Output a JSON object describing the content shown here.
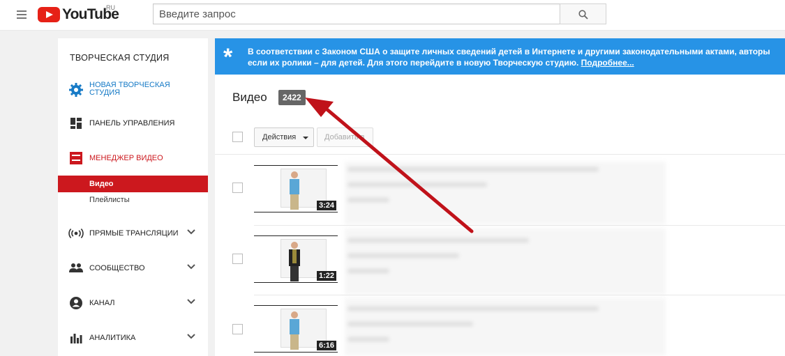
{
  "header": {
    "logo_text": "YouTube",
    "logo_region": "RU",
    "search_placeholder": "Введите запрос"
  },
  "sidebar": {
    "title": "ТВОРЧЕСКАЯ СТУДИЯ",
    "new_studio_line1": "НОВАЯ ТВОРЧЕСКАЯ",
    "new_studio_line2": "СТУДИЯ",
    "items": [
      {
        "label": "ПАНЕЛЬ УПРАВЛЕНИЯ",
        "icon": "dashboard-icon"
      },
      {
        "label": "МЕНЕДЖЕР ВИДЕО",
        "icon": "video-manager-icon"
      },
      {
        "label": "ПРЯМЫЕ ТРАНСЛЯЦИИ",
        "icon": "live-icon"
      },
      {
        "label": "СООБЩЕСТВО",
        "icon": "community-icon"
      },
      {
        "label": "КАНАЛ",
        "icon": "channel-icon"
      },
      {
        "label": "АНАЛИТИКА",
        "icon": "analytics-icon"
      }
    ],
    "sub_items": [
      {
        "label": "Видео",
        "active": true
      },
      {
        "label": "Плейлисты",
        "active": false
      }
    ]
  },
  "banner": {
    "line1": "В соответствии с Законом США о защите личных сведений детей в Интернете и другими законодательными актами, авторы",
    "line2": "если их ролики – для детей. Для этого перейдите в новую Творческую студию.",
    "link": "Подробнее..."
  },
  "main": {
    "title": "Видео",
    "count": "2422",
    "actions_label": "Действия",
    "add_label": "Добавить в"
  },
  "videos": [
    {
      "duration": "3:24"
    },
    {
      "duration": "1:22"
    },
    {
      "duration": "6:16"
    }
  ],
  "colors": {
    "accent_red": "#cc181e",
    "banner_blue": "#2793e6",
    "link_blue": "#167ac6",
    "arrow": "#c0121a"
  }
}
